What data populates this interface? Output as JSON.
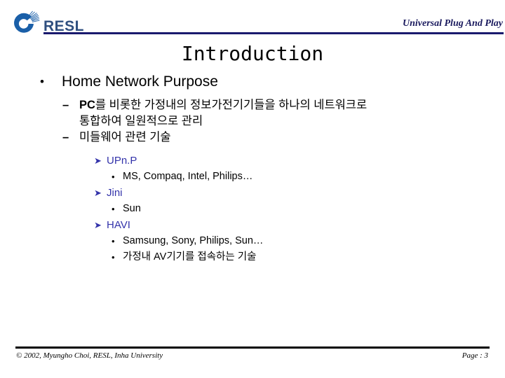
{
  "header": {
    "logo_text": "RESL",
    "logo_icon": "resl-ring-logo",
    "right_title": "Universal Plug And Play",
    "accent_color": "#1a1a6e",
    "logo_color": "#1a5fa8"
  },
  "title": "Introduction",
  "content": {
    "level1": {
      "marker": "•",
      "text": "Home Network Purpose"
    },
    "level2": [
      {
        "marker": "–",
        "lead": "PC",
        "line1": "를 비롯한 가정내의 정보가전기기들을 하나의 네트워크로",
        "line2": "통합하여 일원적으로 관리"
      },
      {
        "marker": "–",
        "lead": "",
        "line1": "미들웨어 관련 기술",
        "line2": ""
      }
    ],
    "groups": [
      {
        "marker": "Ø",
        "label": "UPn.P",
        "color": "#3333aa",
        "items": [
          {
            "marker": "•",
            "text": "MS, Compaq, Intel, Philips…"
          }
        ]
      },
      {
        "marker": "Ø",
        "label": "Jini",
        "color": "#3333aa",
        "items": [
          {
            "marker": "•",
            "text": "Sun"
          }
        ]
      },
      {
        "marker": "Ø",
        "label": "HAVI",
        "color": "#3333aa",
        "items": [
          {
            "marker": "•",
            "text": "Samsung, Sony, Philips, Sun…"
          },
          {
            "marker": "•",
            "text": "가정내 AV기기를 접속하는 기술"
          }
        ]
      }
    ]
  },
  "footer": {
    "copyright": "© 2002, Myungho Choi, RESL, Inha University",
    "page": "Page : 3"
  }
}
